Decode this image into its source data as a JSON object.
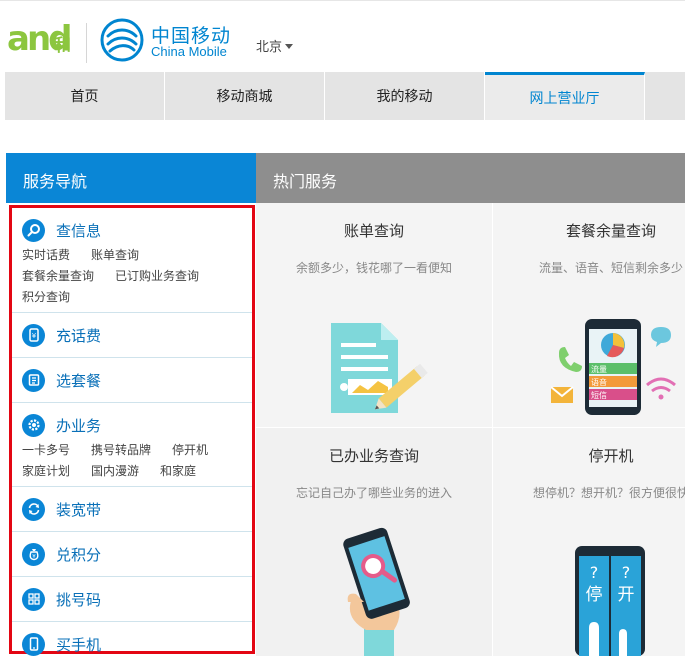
{
  "header": {
    "and_logo_text": "and",
    "he_logo_text": "和",
    "brand_cn": "中国移动",
    "brand_en": "China Mobile",
    "city": "北京"
  },
  "nav": {
    "items": [
      {
        "label": "首页"
      },
      {
        "label": "移动商城"
      },
      {
        "label": "我的移动"
      },
      {
        "label": "网上营业厅"
      }
    ],
    "active_index": 3
  },
  "service_nav": {
    "title": "服务导航",
    "sections": [
      {
        "title": "查信息",
        "icon": "search-icon",
        "links": [
          "实时话费",
          "账单查询",
          "套餐余量查询",
          "已订购业务查询",
          "积分查询"
        ]
      },
      {
        "title": "充话费",
        "icon": "yen-phone-icon",
        "links": []
      },
      {
        "title": "选套餐",
        "icon": "package-icon",
        "links": []
      },
      {
        "title": "办业务",
        "icon": "gear-icon",
        "links": [
          "一卡多号",
          "携号转品牌",
          "停开机",
          "家庭计划",
          "国内漫游",
          "和家庭"
        ]
      },
      {
        "title": "装宽带",
        "icon": "refresh-icon",
        "links": []
      },
      {
        "title": "兑积分",
        "icon": "points-bag-icon",
        "links": []
      },
      {
        "title": "挑号码",
        "icon": "grid-icon",
        "links": []
      },
      {
        "title": "买手机",
        "icon": "phone-icon",
        "links": []
      }
    ]
  },
  "hot_services": {
    "title": "热门服务",
    "cards": [
      {
        "title": "账单查询",
        "desc": "余额多少，钱花哪了一看便知"
      },
      {
        "title": "套餐余量查询",
        "desc": "流量、语音、短信剩余多少"
      },
      {
        "title": "已办业务查询",
        "desc": "忘记自己办了哪些业务的进入"
      },
      {
        "title": "停开机",
        "desc": "想停机？想开机？很方便很快"
      }
    ],
    "phone_screen_rows": [
      "流量",
      "语音",
      "短信"
    ],
    "stop_sign_chars": [
      "停",
      "开"
    ]
  },
  "colors": {
    "brand_blue": "#0a86d6",
    "and_green": "#8cc63f",
    "highlight_red": "#e30613",
    "hot_head_gray": "#8e8e8e"
  }
}
